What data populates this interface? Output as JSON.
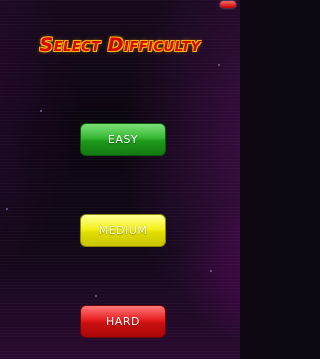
{
  "title": "Select Difficulty",
  "buttons": {
    "easy": "EASY",
    "medium": "MEDIUM",
    "hard": "HARD"
  },
  "colors": {
    "title_fill": "#d50606",
    "title_outline": "#ffb000",
    "easy": "#36b833",
    "medium": "#f4f21a",
    "hard": "#e81d1d",
    "background": "#0c0710"
  }
}
